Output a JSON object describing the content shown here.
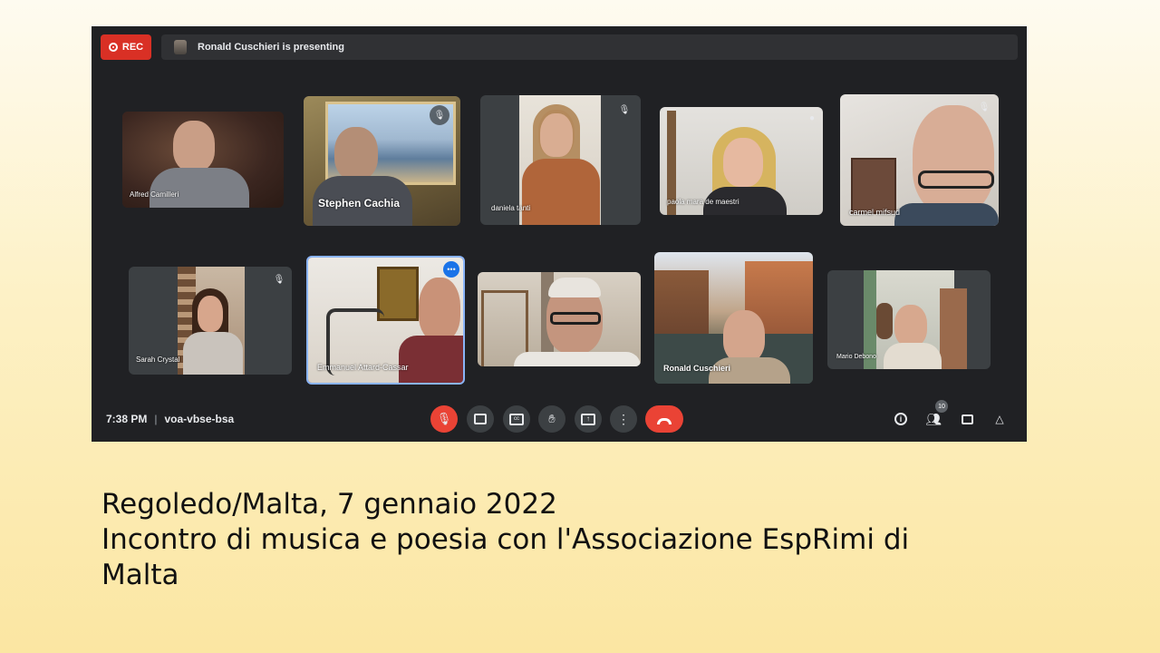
{
  "meeting": {
    "rec_label": "REC",
    "presenting_text": "Ronald Cuschieri is presenting",
    "time": "7:38 PM",
    "separator": "|",
    "meeting_code": "voa-vbse-bsa",
    "participant_count": "10",
    "participants": [
      {
        "name": "Alfred Camilleri"
      },
      {
        "name": "Stephen Cachia"
      },
      {
        "name": "daniela tanti"
      },
      {
        "name": "paola mara de maestri"
      },
      {
        "name": "carmel mifsud"
      },
      {
        "name": "Sarah Crystal"
      },
      {
        "name": "Emmanuel Attard-Cassar"
      },
      {
        "name": ""
      },
      {
        "name": "Ronald Cuschieri"
      },
      {
        "name": "Mario Debono"
      }
    ],
    "controls": {
      "mic": "mic-off-icon",
      "camera": "camera-icon",
      "captions": "captions-icon",
      "hand": "raise-hand-icon",
      "present": "present-icon",
      "more": "more-vert-icon",
      "leave": "call-end-icon"
    },
    "colors": {
      "background": "#202124",
      "tile": "#3c4043",
      "red": "#ea4335",
      "active_border": "#8ab4f8"
    }
  },
  "caption": {
    "line1": "Regoledo/Malta, 7 gennaio 2022",
    "line2": "Incontro di musica e poesia con l'Associazione EspRimi di",
    "line3": "Malta"
  }
}
